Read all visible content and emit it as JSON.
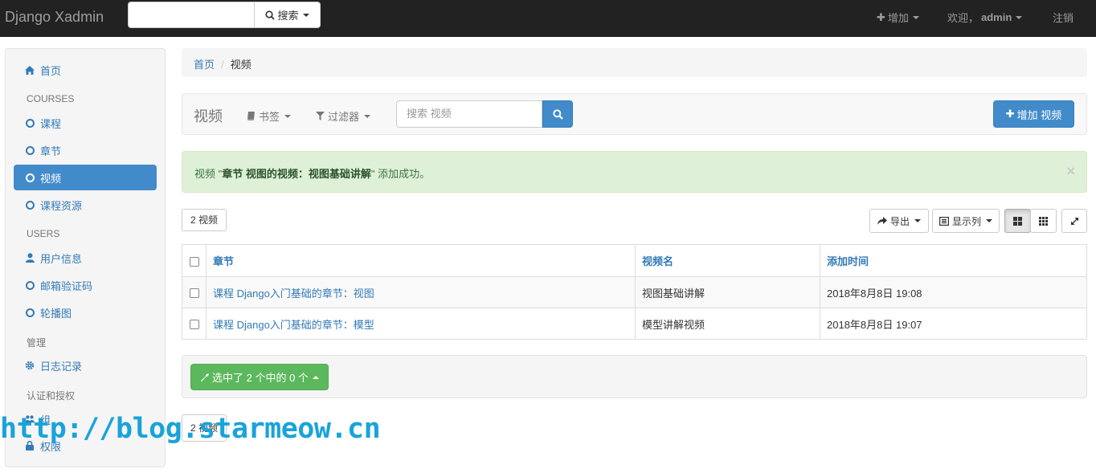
{
  "navbar": {
    "brand": "Django Xadmin",
    "search_button": "搜索",
    "add_menu": "增加",
    "welcome_prefix": "欢迎，",
    "username": "admin",
    "logout": "注销"
  },
  "breadcrumb": {
    "home": "首页",
    "current": "视频"
  },
  "sidebar": {
    "home": "首页",
    "courses_header": "COURSES",
    "course": "课程",
    "chapter": "章节",
    "video": "视频",
    "course_resource": "课程资源",
    "users_header": "USERS",
    "user_info": "用户信息",
    "email_code": "邮箱验证码",
    "banner": "轮播图",
    "manage_header": "管理",
    "log": "日志记录",
    "auth_header": "认证和授权",
    "group": "组",
    "permission": "权限"
  },
  "toolbar": {
    "title": "视频",
    "bookmarks": "书签",
    "filters": "过滤器",
    "search_placeholder": "搜索 视频",
    "add_button": "增加 视频"
  },
  "alert": {
    "prefix": "视频 \"",
    "object": "章节 视图的视频：视图基础讲解",
    "suffix": "\" 添加成功。",
    "close": "×"
  },
  "list": {
    "count": "2 视频",
    "export": "导出",
    "columns_btn": "显示列",
    "headers": [
      "章节",
      "视频名",
      "添加时间"
    ],
    "rows": [
      {
        "chapter": "课程 Django入门基础的章节：视图",
        "name": "视图基础讲解",
        "time": "2018年8月8日 19:08"
      },
      {
        "chapter": "课程 Django入门基础的章节：模型",
        "name": "模型讲解视频",
        "time": "2018年8月8日 19:07"
      }
    ],
    "actions_btn": "选中了 2 个中的 0 个",
    "bottom_count": "2 视频"
  },
  "watermark": "http://blog.starmeow.cn",
  "colors": {
    "primary": "#428bca",
    "success": "#5cb85c",
    "navbar": "#222222",
    "alert_bg": "#dff0d8"
  }
}
